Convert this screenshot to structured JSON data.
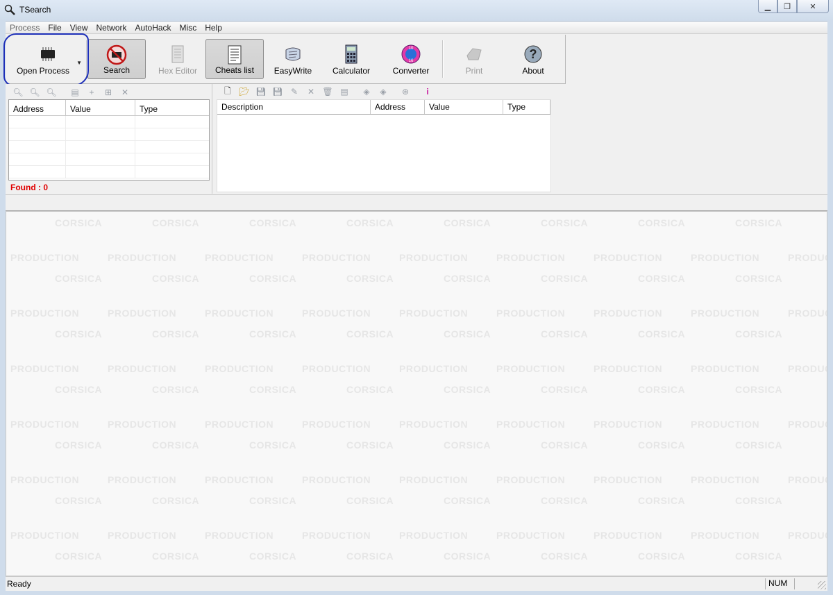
{
  "window": {
    "title": "TSearch"
  },
  "menu": [
    "Process",
    "File",
    "View",
    "Network",
    "AutoHack",
    "Misc",
    "Help"
  ],
  "toolbar": {
    "buttons": [
      {
        "label": "Open Process",
        "icon": "chip-icon",
        "state": "normal"
      },
      {
        "label": "Search",
        "icon": "no-chip-icon",
        "state": "pressed"
      },
      {
        "label": "Hex Editor",
        "icon": "document-icon",
        "state": "disabled"
      },
      {
        "label": "Cheats list",
        "icon": "list-icon",
        "state": "pressed"
      },
      {
        "label": "EasyWrite",
        "icon": "scroll-icon",
        "state": "normal"
      },
      {
        "label": "Calculator",
        "icon": "calculator-icon",
        "state": "normal"
      },
      {
        "label": "Converter",
        "icon": "converter-icon",
        "state": "normal"
      },
      {
        "label": "Print",
        "icon": "printer-icon",
        "state": "disabled"
      },
      {
        "label": "About",
        "icon": "help-icon",
        "state": "normal"
      }
    ]
  },
  "search_panel": {
    "columns": [
      "Address",
      "Value",
      "Type"
    ],
    "found_text": "Found : 0"
  },
  "cheats_panel": {
    "columns": [
      "Description",
      "Address",
      "Value",
      "Type"
    ]
  },
  "watermark": {
    "line1": "CORSICA",
    "line2": "PRODUCTION"
  },
  "status": {
    "text": "Ready",
    "num": "NUM"
  },
  "colors": {
    "found": "#e00000",
    "highlight_ring": "#1d2fb8"
  }
}
